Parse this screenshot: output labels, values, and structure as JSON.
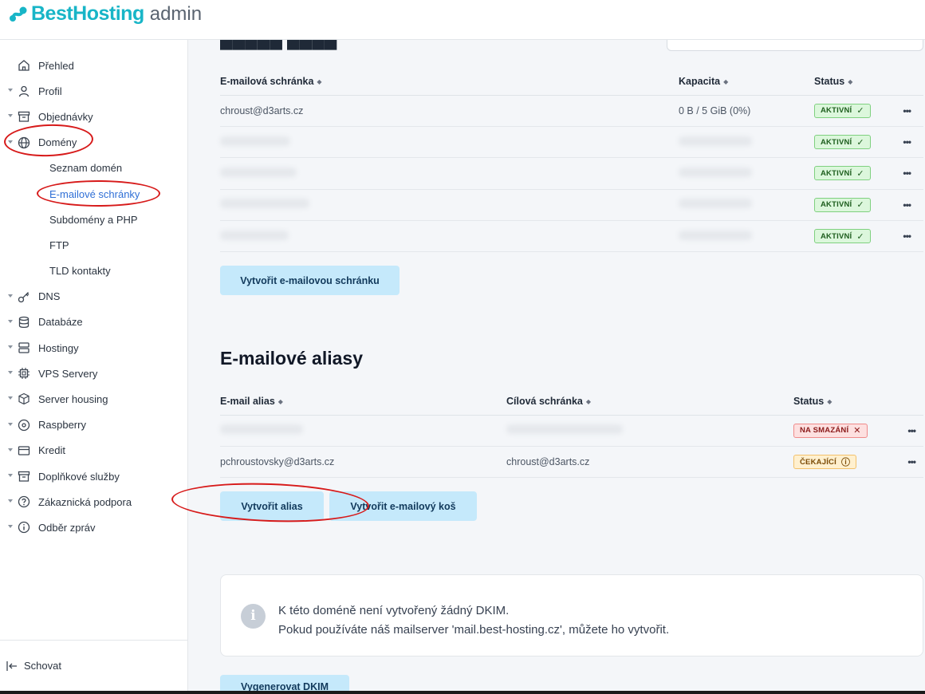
{
  "brand": {
    "name": "BestHosting",
    "suffix": "admin"
  },
  "sidebar": {
    "items": [
      {
        "label": "Přehled",
        "icon": "home-icon",
        "caret": false
      },
      {
        "label": "Profil",
        "icon": "user-icon",
        "caret": true
      },
      {
        "label": "Objednávky",
        "icon": "archive-icon",
        "caret": true
      },
      {
        "label": "Domény",
        "icon": "globe-icon",
        "caret": true
      }
    ],
    "domain_sub": [
      {
        "label": "Seznam domén",
        "active": false
      },
      {
        "label": "E-mailové schránky",
        "active": true
      },
      {
        "label": "Subdomény a PHP",
        "active": false
      },
      {
        "label": "FTP",
        "active": false
      },
      {
        "label": "TLD kontakty",
        "active": false
      }
    ],
    "items_after": [
      {
        "label": "DNS",
        "icon": "key-icon"
      },
      {
        "label": "Databáze",
        "icon": "database-icon"
      },
      {
        "label": "Hostingy",
        "icon": "server-icon"
      },
      {
        "label": "VPS Servery",
        "icon": "cpu-icon"
      },
      {
        "label": "Server housing",
        "icon": "box-icon"
      },
      {
        "label": "Raspberry",
        "icon": "disc-icon"
      },
      {
        "label": "Kredit",
        "icon": "credit-card-icon"
      },
      {
        "label": "Doplňkové služby",
        "icon": "archive-icon"
      },
      {
        "label": "Zákaznická podpora",
        "icon": "help-circle-icon"
      },
      {
        "label": "Odběr zpráv",
        "icon": "info-circle-icon"
      }
    ],
    "hide_label": "Schovat"
  },
  "mailboxes": {
    "columns": [
      "E-mailová schránka",
      "Kapacita",
      "Status"
    ],
    "rows": [
      {
        "mailbox": "chroust@d3arts.cz",
        "capacity": "0 B / 5 GiB (0%)",
        "status": "AKTIVNÍ",
        "blurred": false
      },
      {
        "mailbox": "",
        "capacity": "",
        "status": "AKTIVNÍ",
        "blurred": true
      },
      {
        "mailbox": "",
        "capacity": "",
        "status": "AKTIVNÍ",
        "blurred": true
      },
      {
        "mailbox": "",
        "capacity": "",
        "status": "AKTIVNÍ",
        "blurred": true
      },
      {
        "mailbox": "",
        "capacity": "",
        "status": "AKTIVNÍ",
        "blurred": true
      }
    ],
    "create_label": "Vytvořit e-mailovou schránku"
  },
  "aliases": {
    "title": "E-mailové aliasy",
    "columns": [
      "E-mail alias",
      "Cílová schránka",
      "Status"
    ],
    "rows": [
      {
        "alias": "",
        "target": "",
        "status": "NA SMAZÁNÍ",
        "kind": "del",
        "blurred": true
      },
      {
        "alias": "pchroustovsky@d3arts.cz",
        "target": "chroust@d3arts.cz",
        "status": "ČEKAJÍCÍ",
        "kind": "wait",
        "blurred": false
      }
    ],
    "create_alias_label": "Vytvořit alias",
    "create_bin_label": "Vytvořit e-mailový koš"
  },
  "dkim": {
    "line1": "K této doméně není vytvořený žádný DKIM.",
    "line2": "Pokud používáte náš mailserver 'mail.best-hosting.cz', můžete ho vytvořit.",
    "button_label": "Vygenerovat DKIM"
  },
  "colors": {
    "brand": "#18b5c7",
    "active_link": "#2f6fd6",
    "button_bg": "#c5e9fb",
    "annotation": "#d71a1a"
  }
}
